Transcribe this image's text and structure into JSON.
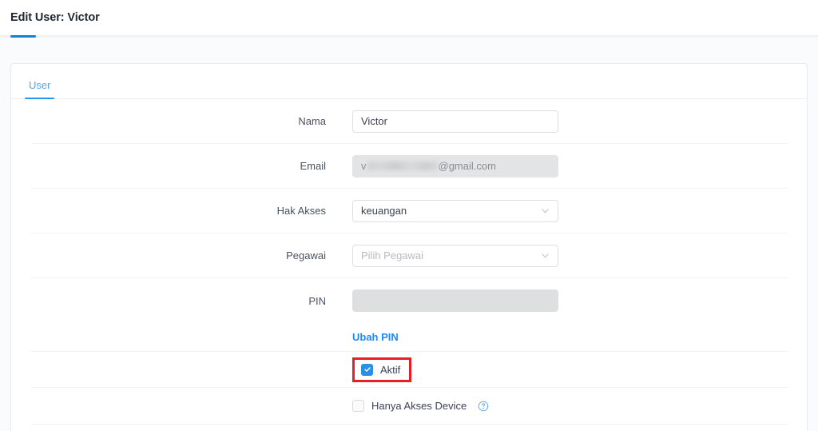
{
  "header": {
    "title": "Edit User: Victor",
    "progress_percent": 3
  },
  "tabs": [
    {
      "label": "User",
      "active": true
    }
  ],
  "form": {
    "fields": [
      {
        "label": "Nama",
        "type": "text",
        "value": "Victor",
        "placeholder": "",
        "disabled": false
      },
      {
        "label": "Email",
        "type": "text-redacted",
        "value_prefix": "v",
        "value_suffix": "@gmail.com",
        "placeholder": "",
        "disabled": true
      },
      {
        "label": "Hak Akses",
        "type": "select",
        "value": "keuangan",
        "placeholder": "",
        "disabled": false
      },
      {
        "label": "Pegawai",
        "type": "select",
        "value": "",
        "placeholder": "Pilih Pegawai",
        "disabled": false
      },
      {
        "label": "PIN",
        "type": "text",
        "value": "",
        "placeholder": "",
        "disabled": true
      }
    ],
    "pin_link": "Ubah PIN",
    "checkboxes": [
      {
        "label": "Aktif",
        "checked": true,
        "highlighted": true,
        "help": false
      },
      {
        "label": "Hanya Akses Device",
        "checked": false,
        "highlighted": false,
        "help": true
      }
    ]
  },
  "icons": {
    "chevron_down": "chevron-down-icon",
    "check": "check-icon",
    "help": "help-circle-icon"
  },
  "colors": {
    "accent": "#1283d4",
    "tab_active": "#2196f3",
    "link": "#1a8cff",
    "checkbox_on": "#2b8fe3",
    "annotation": "#ec1c24",
    "page_bg": "#fafbfc",
    "card_bg": "#ffffff",
    "disabled_bg": "#e3e4e6"
  }
}
